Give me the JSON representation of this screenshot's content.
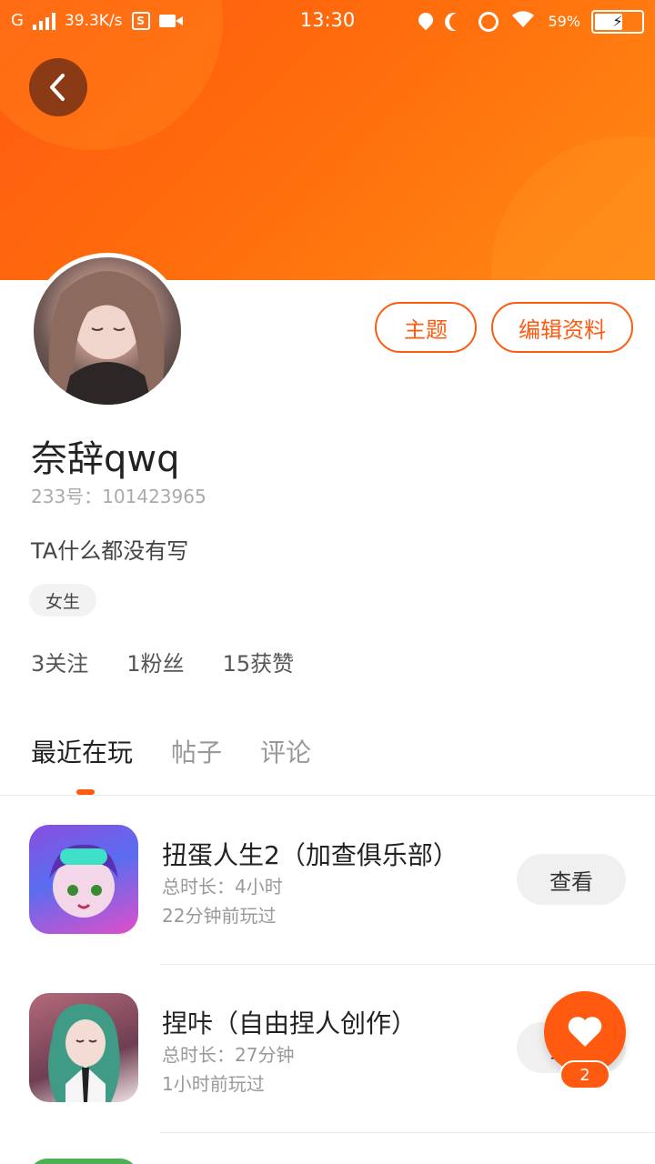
{
  "status_bar": {
    "carrier": "G",
    "net_speed": "39.3K/s",
    "s_badge": "S",
    "time": "13:30",
    "wifi_icon": "wifi-icon",
    "battery_pct": "59%",
    "battery_level": 0.59
  },
  "profile": {
    "name": "奈辞qwq",
    "uid": "233号：101423965",
    "bio": "TA什么都没有写",
    "gender_tag": "女生",
    "stats": {
      "following": "3关注",
      "fans": "1粉丝",
      "likes": "15获赞"
    },
    "buttons": {
      "topic": "主题",
      "edit_profile": "编辑资料"
    }
  },
  "tabs": [
    {
      "label": "最近在玩",
      "active": true
    },
    {
      "label": "帖子",
      "active": false
    },
    {
      "label": "评论",
      "active": false
    }
  ],
  "games": [
    {
      "title": "扭蛋人生2（加查俱乐部）",
      "total_time": "总时长：4小时",
      "last_played": "22分钟前玩过",
      "button": "查看"
    },
    {
      "title": "捏咔（自由捏人创作）",
      "total_time": "总时长：27分钟",
      "last_played": "1小时前玩过",
      "button": "查看"
    }
  ],
  "fab": {
    "icon": "heart-icon",
    "count": "2"
  },
  "colors": {
    "accent": "#ff5a0f",
    "hero_start": "#ff5a10",
    "hero_end": "#ff8a14"
  }
}
